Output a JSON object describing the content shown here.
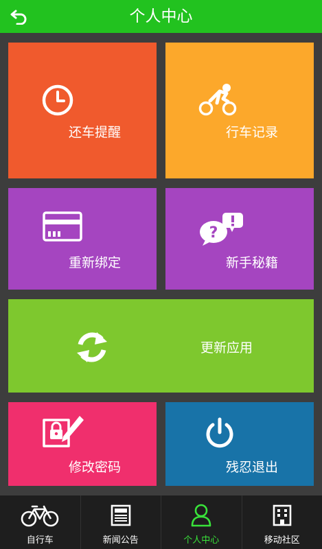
{
  "header": {
    "title": "个人中心",
    "back_icon": "back-arrow-icon",
    "color": "#22c21f"
  },
  "tiles": [
    {
      "label": "还车提醒",
      "icon": "clock-icon",
      "color": "#f05a2d"
    },
    {
      "label": "行车记录",
      "icon": "cyclist-icon",
      "color": "#fca82b"
    },
    {
      "label": "重新绑定",
      "icon": "card-icon",
      "color": "#a545c0"
    },
    {
      "label": "新手秘籍",
      "icon": "help-chat-icon",
      "color": "#a545c0"
    },
    {
      "label": "更新应用",
      "icon": "refresh-icon",
      "color": "#7ec82e"
    },
    {
      "label": "修改密码",
      "icon": "lock-edit-icon",
      "color": "#f02f6d"
    },
    {
      "label": "残忍退出",
      "icon": "power-icon",
      "color": "#1873a8"
    }
  ],
  "bottom_nav": {
    "active_color": "#39e33a",
    "items": [
      {
        "label": "自行车",
        "icon": "bicycle-icon",
        "active": false
      },
      {
        "label": "新闻公告",
        "icon": "newspaper-icon",
        "active": false
      },
      {
        "label": "个人中心",
        "icon": "person-icon",
        "active": true
      },
      {
        "label": "移动社区",
        "icon": "building-icon",
        "active": false
      }
    ]
  }
}
